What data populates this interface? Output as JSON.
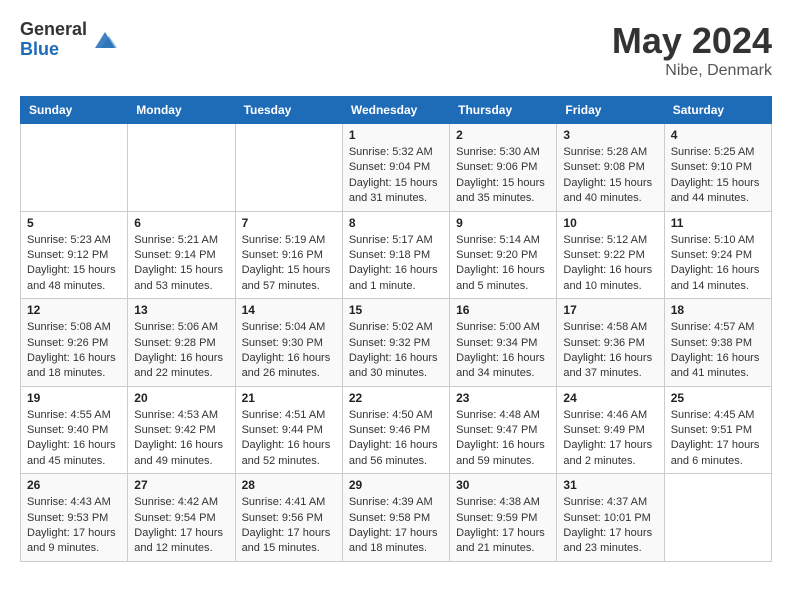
{
  "logo": {
    "general": "General",
    "blue": "Blue"
  },
  "title": "May 2024",
  "subtitle": "Nibe, Denmark",
  "days_of_week": [
    "Sunday",
    "Monday",
    "Tuesday",
    "Wednesday",
    "Thursday",
    "Friday",
    "Saturday"
  ],
  "weeks": [
    [
      {
        "day": "",
        "info": ""
      },
      {
        "day": "",
        "info": ""
      },
      {
        "day": "",
        "info": ""
      },
      {
        "day": "1",
        "sunrise": "5:32 AM",
        "sunset": "9:04 PM",
        "daylight": "15 hours and 31 minutes."
      },
      {
        "day": "2",
        "sunrise": "5:30 AM",
        "sunset": "9:06 PM",
        "daylight": "15 hours and 35 minutes."
      },
      {
        "day": "3",
        "sunrise": "5:28 AM",
        "sunset": "9:08 PM",
        "daylight": "15 hours and 40 minutes."
      },
      {
        "day": "4",
        "sunrise": "5:25 AM",
        "sunset": "9:10 PM",
        "daylight": "15 hours and 44 minutes."
      }
    ],
    [
      {
        "day": "5",
        "sunrise": "5:23 AM",
        "sunset": "9:12 PM",
        "daylight": "15 hours and 48 minutes."
      },
      {
        "day": "6",
        "sunrise": "5:21 AM",
        "sunset": "9:14 PM",
        "daylight": "15 hours and 53 minutes."
      },
      {
        "day": "7",
        "sunrise": "5:19 AM",
        "sunset": "9:16 PM",
        "daylight": "15 hours and 57 minutes."
      },
      {
        "day": "8",
        "sunrise": "5:17 AM",
        "sunset": "9:18 PM",
        "daylight": "16 hours and 1 minute."
      },
      {
        "day": "9",
        "sunrise": "5:14 AM",
        "sunset": "9:20 PM",
        "daylight": "16 hours and 5 minutes."
      },
      {
        "day": "10",
        "sunrise": "5:12 AM",
        "sunset": "9:22 PM",
        "daylight": "16 hours and 10 minutes."
      },
      {
        "day": "11",
        "sunrise": "5:10 AM",
        "sunset": "9:24 PM",
        "daylight": "16 hours and 14 minutes."
      }
    ],
    [
      {
        "day": "12",
        "sunrise": "5:08 AM",
        "sunset": "9:26 PM",
        "daylight": "16 hours and 18 minutes."
      },
      {
        "day": "13",
        "sunrise": "5:06 AM",
        "sunset": "9:28 PM",
        "daylight": "16 hours and 22 minutes."
      },
      {
        "day": "14",
        "sunrise": "5:04 AM",
        "sunset": "9:30 PM",
        "daylight": "16 hours and 26 minutes."
      },
      {
        "day": "15",
        "sunrise": "5:02 AM",
        "sunset": "9:32 PM",
        "daylight": "16 hours and 30 minutes."
      },
      {
        "day": "16",
        "sunrise": "5:00 AM",
        "sunset": "9:34 PM",
        "daylight": "16 hours and 34 minutes."
      },
      {
        "day": "17",
        "sunrise": "4:58 AM",
        "sunset": "9:36 PM",
        "daylight": "16 hours and 37 minutes."
      },
      {
        "day": "18",
        "sunrise": "4:57 AM",
        "sunset": "9:38 PM",
        "daylight": "16 hours and 41 minutes."
      }
    ],
    [
      {
        "day": "19",
        "sunrise": "4:55 AM",
        "sunset": "9:40 PM",
        "daylight": "16 hours and 45 minutes."
      },
      {
        "day": "20",
        "sunrise": "4:53 AM",
        "sunset": "9:42 PM",
        "daylight": "16 hours and 49 minutes."
      },
      {
        "day": "21",
        "sunrise": "4:51 AM",
        "sunset": "9:44 PM",
        "daylight": "16 hours and 52 minutes."
      },
      {
        "day": "22",
        "sunrise": "4:50 AM",
        "sunset": "9:46 PM",
        "daylight": "16 hours and 56 minutes."
      },
      {
        "day": "23",
        "sunrise": "4:48 AM",
        "sunset": "9:47 PM",
        "daylight": "16 hours and 59 minutes."
      },
      {
        "day": "24",
        "sunrise": "4:46 AM",
        "sunset": "9:49 PM",
        "daylight": "17 hours and 2 minutes."
      },
      {
        "day": "25",
        "sunrise": "4:45 AM",
        "sunset": "9:51 PM",
        "daylight": "17 hours and 6 minutes."
      }
    ],
    [
      {
        "day": "26",
        "sunrise": "4:43 AM",
        "sunset": "9:53 PM",
        "daylight": "17 hours and 9 minutes."
      },
      {
        "day": "27",
        "sunrise": "4:42 AM",
        "sunset": "9:54 PM",
        "daylight": "17 hours and 12 minutes."
      },
      {
        "day": "28",
        "sunrise": "4:41 AM",
        "sunset": "9:56 PM",
        "daylight": "17 hours and 15 minutes."
      },
      {
        "day": "29",
        "sunrise": "4:39 AM",
        "sunset": "9:58 PM",
        "daylight": "17 hours and 18 minutes."
      },
      {
        "day": "30",
        "sunrise": "4:38 AM",
        "sunset": "9:59 PM",
        "daylight": "17 hours and 21 minutes."
      },
      {
        "day": "31",
        "sunrise": "4:37 AM",
        "sunset": "10:01 PM",
        "daylight": "17 hours and 23 minutes."
      },
      {
        "day": "",
        "info": ""
      }
    ]
  ]
}
